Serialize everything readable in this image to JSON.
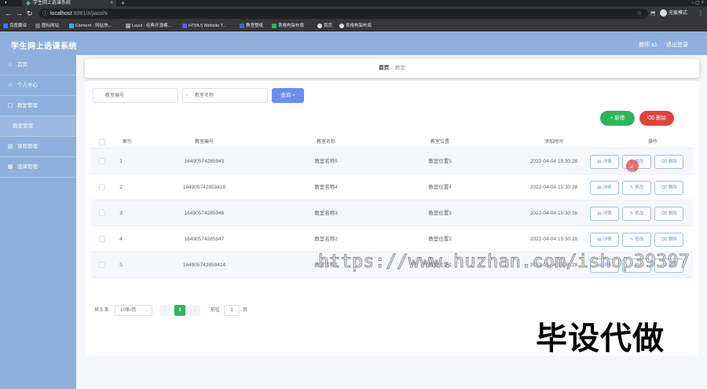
{
  "browser": {
    "tab_title": "学生网上选课系统",
    "tab_close": "×",
    "new_tab": "+",
    "window_controls": "– ▢ ×",
    "url_host": "localhost",
    "url_path": ":8081/#/jiaoshi",
    "profile_label": "无痕模式",
    "icons": {
      "back": "back-arrow-icon",
      "forward": "forward-arrow-icon",
      "reload": "reload-icon",
      "home": "home-icon"
    },
    "bookmarks": [
      {
        "label": "百度翻译",
        "color": "#3a72e8"
      },
      {
        "label": "图标网站",
        "color": "#555555"
      },
      {
        "label": "Element - 网站快...",
        "color": "#409eff"
      },
      {
        "label": "Layui - 经典开源模...",
        "color": "#333333"
      },
      {
        "label": "HTML5 Website T...",
        "color": "#5b5bd6"
      },
      {
        "label": "教室整纸",
        "color": "#4a6aa5"
      },
      {
        "label": "表格构架布局",
        "color": "#2fb45d"
      },
      {
        "label": "首页",
        "color": "#dddddd"
      },
      {
        "label": "表格构架布局",
        "color": "#dddddd"
      }
    ]
  },
  "header": {
    "title": "学生网上选课系统",
    "user": "教师 a1",
    "logout": "退出登录"
  },
  "sidebar": {
    "items": [
      {
        "label": "首页",
        "icon": "home-icon",
        "glyph": "⌂"
      },
      {
        "label": "个人中心",
        "icon": "user-icon",
        "glyph": "👤"
      },
      {
        "label": "教室管理",
        "icon": "classroom-icon",
        "glyph": "▢"
      },
      {
        "label": "教室管理",
        "icon": "submenu-item",
        "glyph": ""
      },
      {
        "label": "课程管理",
        "icon": "course-icon",
        "glyph": "▤"
      },
      {
        "label": "选课管理",
        "icon": "selection-icon",
        "glyph": "▦"
      }
    ]
  },
  "breadcrumb": {
    "home": "首页",
    "separator": "/",
    "current": "教室"
  },
  "search": {
    "number_placeholder": "教室编号",
    "name_placeholder": "教室名称",
    "query_label": "查询",
    "query_glyph": "⌕"
  },
  "actions": {
    "add_label": "新增",
    "add_glyph": "+",
    "delete_label": "删除",
    "delete_glyph": "🗑"
  },
  "table": {
    "headers": [
      "索引",
      "教室编号",
      "教室名称",
      "教室位置",
      "添加时间",
      "操作"
    ],
    "row_buttons": {
      "detail": "详情",
      "edit": "修改",
      "delete": "删除",
      "detail_glyph": "▤",
      "edit_glyph": "✎",
      "delete_glyph": "🗑"
    },
    "rows": [
      {
        "index": "1",
        "number": "16490574285943",
        "name": "教室名称5",
        "location": "教室位置5",
        "added": "2022-04-04 15:30:28"
      },
      {
        "index": "2",
        "number": "164905742859419",
        "name": "教室名称4",
        "location": "教室位置4",
        "added": "2022-04-04 15:30:28"
      },
      {
        "index": "3",
        "number": "16490574285946",
        "name": "教室名称3",
        "location": "教室位置3",
        "added": "2022-04-04 15:30:28"
      },
      {
        "index": "4",
        "number": "16490574285947",
        "name": "教室名称2",
        "location": "教室位置2",
        "added": "2022-04-04 15:30:28"
      },
      {
        "index": "5",
        "number": "164905742859414",
        "name": "教室名称1",
        "location": "教室位置1",
        "added": "2022-04-04 15:30:28"
      }
    ]
  },
  "pagination": {
    "total": "共 5 条",
    "page_size": "10条/页",
    "current_page": "1",
    "goto_label": "前往",
    "goto_value": "1",
    "unit": "页",
    "prev_glyph": "‹",
    "next_glyph": "›"
  },
  "overlay": {
    "watermark": "https://www.huzhan.com/ishop39397",
    "caption": "毕设代做"
  },
  "colors": {
    "sidebar_bg": "#8fb0dc",
    "primary": "#6a8ef6",
    "success": "#2fb45d",
    "danger": "#e2423d"
  }
}
